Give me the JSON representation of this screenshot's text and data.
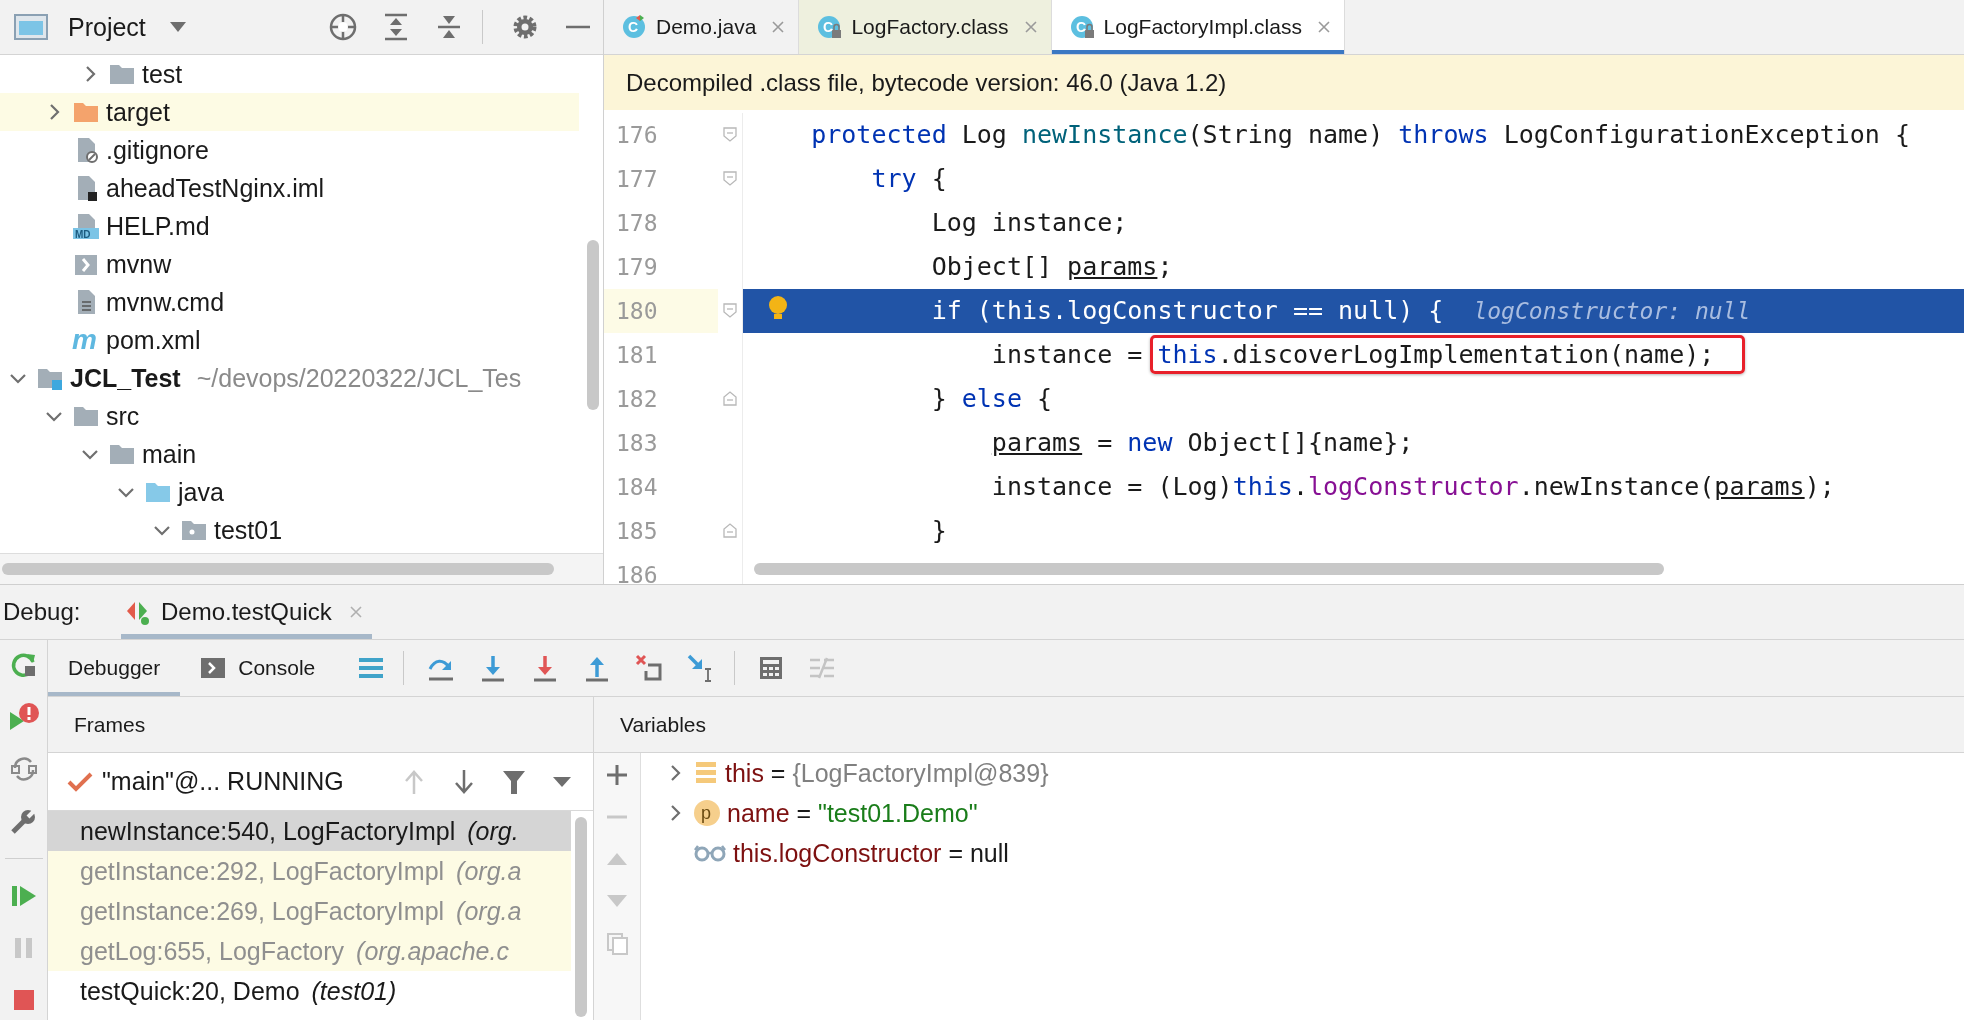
{
  "project_panel": {
    "title": "Project",
    "toolbar": [
      {
        "kind": "locate"
      },
      {
        "kind": "expand-all"
      },
      {
        "kind": "collapse-all"
      },
      {
        "kind": "settings"
      },
      {
        "kind": "hide"
      }
    ],
    "tree": [
      {
        "children": [
          {
            "children": [
              {
                "label": "test",
                "kind": "folder",
                "expanded": false,
                "highlighted": false
              }
            ]
          },
          {
            "label": "target",
            "kind": "excluded-folder",
            "expanded": false,
            "highlighted": true
          },
          {
            "label": ".gitignore",
            "kind": "ignore-file",
            "highlighted": false
          },
          {
            "label": "aheadTestNginx.iml",
            "kind": "module-file",
            "highlighted": false
          },
          {
            "label": "HELP.md",
            "kind": "markdown",
            "icon_text": "MD",
            "highlighted": false
          },
          {
            "label": "mvnw",
            "kind": "shell",
            "highlighted": false
          },
          {
            "label": "mvnw.cmd",
            "kind": "text",
            "highlighted": false
          },
          {
            "label": "pom.xml",
            "kind": "maven",
            "icon_text": "m",
            "highlighted": false
          }
        ]
      },
      {
        "label": "JCL_Test",
        "hint": "~/devops/20220322/JCL_Tes",
        "kind": "module",
        "expanded": true,
        "highlighted": false,
        "children": [
          {
            "label": "src",
            "kind": "folder",
            "expanded": true,
            "highlighted": false,
            "children": [
              {
                "label": "main",
                "kind": "folder",
                "expanded": true,
                "highlighted": false,
                "children": [
                  {
                    "label": "java",
                    "kind": "source-folder",
                    "expanded": true,
                    "highlighted": false,
                    "children": [
                      {
                        "label": "test01",
                        "kind": "package",
                        "expanded": true,
                        "highlighted": false
                      }
                    ]
                  }
                ]
              }
            ]
          }
        ]
      }
    ]
  },
  "editor": {
    "tabs": [
      {
        "label": "Demo.java",
        "kind": "java",
        "icon_text": "C",
        "selected": false,
        "highlighted": false
      },
      {
        "label": "LogFactory.class",
        "kind": "class",
        "icon_text": "C",
        "selected": false,
        "highlighted": true
      },
      {
        "label": "LogFactoryImpl.class",
        "kind": "class",
        "icon_text": "C",
        "selected": true,
        "highlighted": false
      }
    ],
    "banner": "Decompiled .class file, bytecode version: 46.0 (Java 1.2)",
    "lines": [
      {
        "number": "176",
        "fold_start": true,
        "fold_end": false,
        "current": false,
        "intention": false,
        "tokens": [
          {
            "kind": "keyword",
            "t": "    protected"
          },
          {
            "kind": "plain",
            "t": " Log "
          },
          {
            "kind": "method",
            "t": "newInstance"
          },
          {
            "kind": "plain",
            "t": "(String name) "
          },
          {
            "kind": "keyword",
            "t": "throws"
          },
          {
            "kind": "plain",
            "t": " LogConfigurationException {"
          }
        ]
      },
      {
        "number": "177",
        "fold_start": true,
        "fold_end": false,
        "current": false,
        "intention": false,
        "tokens": [
          {
            "kind": "keyword",
            "t": "        try"
          },
          {
            "kind": "plain",
            "t": " {"
          }
        ]
      },
      {
        "number": "178",
        "fold_start": false,
        "fold_end": false,
        "current": false,
        "intention": false,
        "tokens": [
          {
            "kind": "plain",
            "t": "            Log instance;"
          }
        ]
      },
      {
        "number": "179",
        "fold_start": false,
        "fold_end": false,
        "current": false,
        "intention": false,
        "tokens": [
          {
            "kind": "plain",
            "t": "            Object[] "
          },
          {
            "kind": "reassigned",
            "t": "params"
          },
          {
            "kind": "plain",
            "t": ";"
          }
        ]
      },
      {
        "number": "180",
        "fold_start": true,
        "fold_end": false,
        "current": true,
        "intention": true,
        "hint": "logConstructor: null",
        "tokens": [
          {
            "kind": "plain",
            "t": "            if ("
          },
          {
            "kind": "keyword",
            "t": "this"
          },
          {
            "kind": "plain",
            "t": ".logConstructor == null) {"
          }
        ]
      },
      {
        "number": "181",
        "fold_start": false,
        "fold_end": false,
        "current": false,
        "intention": false,
        "tokens": [
          {
            "kind": "plain",
            "t": "                instance = "
          },
          {
            "kind": "keyword",
            "t": "this",
            "boxed": true
          },
          {
            "kind": "plain",
            "t": ".discoverLogImplementation(name);",
            "boxed": true
          }
        ]
      },
      {
        "number": "182",
        "fold_start": false,
        "fold_end": true,
        "current": false,
        "intention": false,
        "tokens": [
          {
            "kind": "plain",
            "t": "            } "
          },
          {
            "kind": "keyword",
            "t": "else"
          },
          {
            "kind": "plain",
            "t": " {"
          }
        ]
      },
      {
        "number": "183",
        "fold_start": false,
        "fold_end": false,
        "current": false,
        "intention": false,
        "tokens": [
          {
            "kind": "reassigned",
            "t": "                params"
          },
          {
            "kind": "plain",
            "t": " = "
          },
          {
            "kind": "keyword",
            "t": "new"
          },
          {
            "kind": "plain",
            "t": " Object[]{name};"
          }
        ]
      },
      {
        "number": "184",
        "fold_start": false,
        "fold_end": false,
        "current": false,
        "intention": false,
        "tokens": [
          {
            "kind": "plain",
            "t": "                instance = (Log)"
          },
          {
            "kind": "keyword",
            "t": "this"
          },
          {
            "kind": "plain",
            "t": "."
          },
          {
            "kind": "field",
            "t": "logConstructor"
          },
          {
            "kind": "plain",
            "t": ".newInstance("
          },
          {
            "kind": "reassigned",
            "t": "params"
          },
          {
            "kind": "plain",
            "t": ");"
          }
        ]
      },
      {
        "number": "185",
        "fold_start": false,
        "fold_end": true,
        "current": false,
        "intention": false,
        "tokens": [
          {
            "kind": "plain",
            "t": "            }"
          }
        ]
      },
      {
        "number": "186",
        "fold_start": false,
        "fold_end": false,
        "current": false
      }
    ]
  },
  "debug": {
    "title": "Debug:",
    "sessions": [
      {
        "label": "Demo.testQuick",
        "selected": true
      }
    ],
    "tabs": [
      {
        "label": "Debugger",
        "kind": "debugger",
        "selected": true
      },
      {
        "label": "Console",
        "kind": "console",
        "selected": false
      }
    ],
    "toolbar": [
      {
        "kind": "layout",
        "disabled": false
      },
      {
        "kind": "divider"
      },
      {
        "kind": "step-over",
        "disabled": false
      },
      {
        "kind": "step-into",
        "disabled": false
      },
      {
        "kind": "force-step-into",
        "disabled": false
      },
      {
        "kind": "step-out",
        "disabled": false
      },
      {
        "kind": "drop-frame",
        "disabled": false
      },
      {
        "kind": "run-to-cursor",
        "disabled": false
      },
      {
        "kind": "divider"
      },
      {
        "kind": "evaluate",
        "disabled": false
      },
      {
        "kind": "trace",
        "disabled": true
      }
    ],
    "side_toolbar": [
      {
        "kind": "rerun"
      },
      {
        "kind": "rerun-failed"
      },
      {
        "kind": "restore"
      },
      {
        "kind": "settings"
      },
      {
        "kind": "divider"
      },
      {
        "kind": "resume"
      },
      {
        "kind": "pause"
      },
      {
        "kind": "stop"
      }
    ],
    "frames": {
      "title": "Frames",
      "thread": "\"main\"@... RUNNING",
      "toolbar": [
        {
          "kind": "up",
          "disabled": true
        },
        {
          "kind": "down",
          "disabled": false
        },
        {
          "kind": "filter",
          "disabled": false
        },
        {
          "kind": "dropdown",
          "disabled": false
        }
      ],
      "items": [
        {
          "method": "newInstance:540, LogFactoryImpl",
          "package": "(org.",
          "selected": true,
          "library": false
        },
        {
          "method": "getInstance:292, LogFactoryImpl",
          "package": "(org.a",
          "selected": false,
          "library": true
        },
        {
          "method": "getInstance:269, LogFactoryImpl",
          "package": "(org.a",
          "selected": false,
          "library": true
        },
        {
          "method": "getLog:655, LogFactory",
          "package": "(org.apache.c",
          "selected": false,
          "library": true
        },
        {
          "method": "testQuick:20, Demo",
          "package": "(test01)",
          "selected": false,
          "library": false
        }
      ]
    },
    "variables": {
      "title": "Variables",
      "side_toolbar": [
        {
          "kind": "add",
          "disabled": false
        },
        {
          "kind": "remove",
          "disabled": true
        },
        {
          "kind": "move-up",
          "disabled": true
        },
        {
          "kind": "move-down",
          "disabled": true
        },
        {
          "kind": "copy",
          "disabled": true
        }
      ],
      "items": [
        {
          "kind": "object",
          "name": "this",
          "operator": "=",
          "value": {
            "text": "{LogFactoryImpl@839}",
            "kind": "object"
          },
          "expandable": true
        },
        {
          "kind": "parameter",
          "icon_text": "p",
          "name": "name",
          "operator": "=",
          "value": {
            "text": "\"test01.Demo\"",
            "kind": "string"
          },
          "expandable": true
        },
        {
          "kind": "watch",
          "name": "this.logConstructor",
          "operator": "=",
          "value": {
            "text": "null",
            "kind": "plain"
          },
          "expandable": false
        }
      ]
    }
  }
}
